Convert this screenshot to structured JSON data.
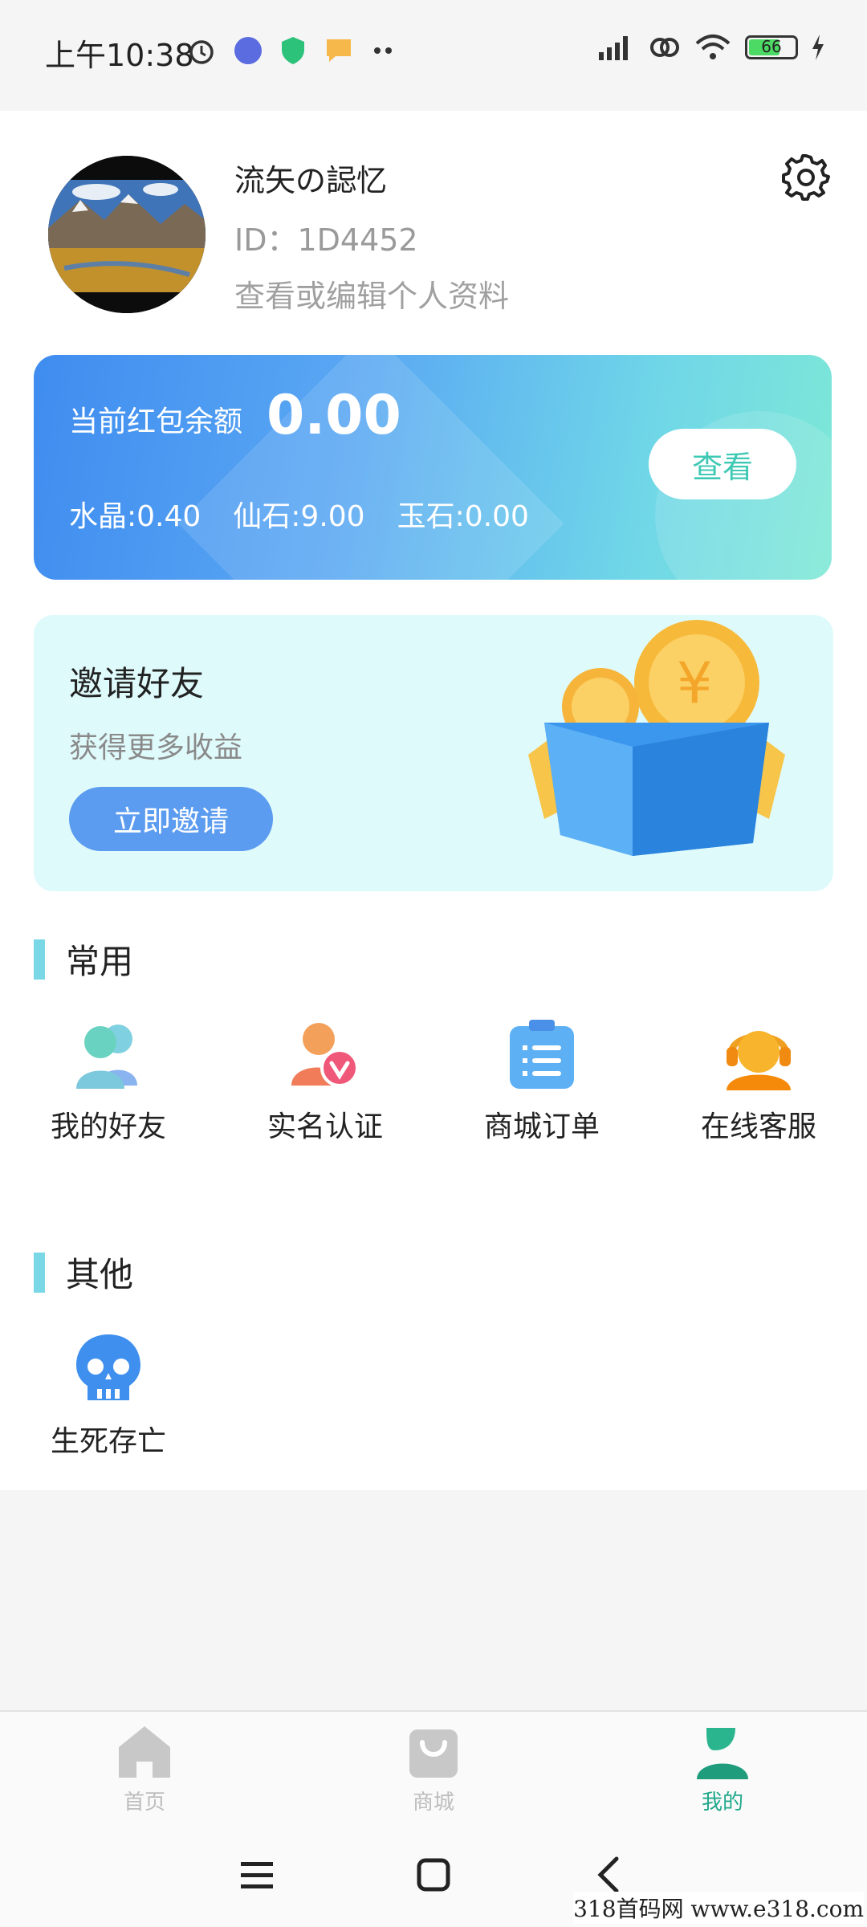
{
  "status_bar": {
    "time": "上午10:38",
    "battery": "66"
  },
  "profile": {
    "username": "流矢の誋忆",
    "user_id": "ID：1D4452",
    "edit_link": "查看或编辑个人资料"
  },
  "balance": {
    "label": "当前红包余额",
    "amount": "0.00",
    "crystal": "水晶:0.40",
    "fairy_stone": "仙石:9.00",
    "jade_stone": "玉石:0.00",
    "view_button": "查看"
  },
  "invite": {
    "title": "邀请好友",
    "subtitle": "获得更多收益",
    "button": "立即邀请"
  },
  "sections": {
    "common_title": "常用",
    "common_items": [
      {
        "label": "我的好友",
        "icon": "friends-icon"
      },
      {
        "label": "实名认证",
        "icon": "verify-icon"
      },
      {
        "label": "商城订单",
        "icon": "orders-icon"
      },
      {
        "label": "在线客服",
        "icon": "support-icon"
      }
    ],
    "other_title": "其他",
    "other_items": [
      {
        "label": "生死存亡",
        "icon": "skull-icon"
      }
    ]
  },
  "bottom_nav": {
    "items": [
      {
        "label": "首页",
        "icon": "home-icon",
        "active": false
      },
      {
        "label": "商城",
        "icon": "shop-bag-icon",
        "active": false
      },
      {
        "label": "我的",
        "icon": "profile-icon",
        "active": true
      }
    ]
  },
  "watermark": "318首码网 www.e318.com",
  "colors": {
    "accent_green": "#22a88c",
    "card_blue": "#3f8cf0",
    "card_teal": "#7ee8d6",
    "invite_bg": "#dffafb",
    "invite_button": "#5b9bf0"
  }
}
